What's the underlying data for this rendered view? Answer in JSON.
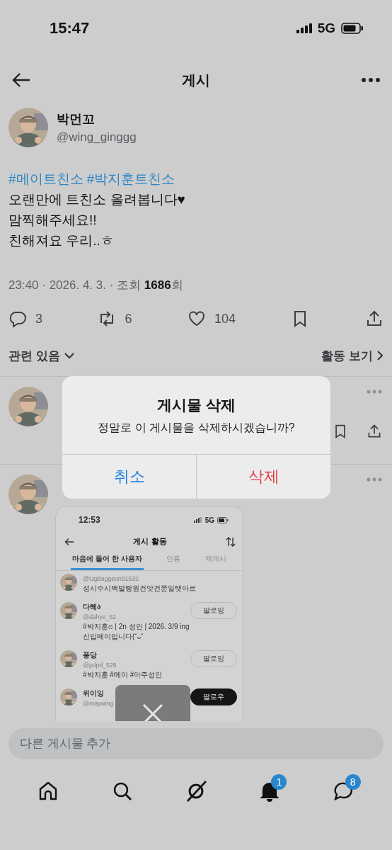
{
  "status_bar": {
    "time": "15:47",
    "network": "5G"
  },
  "header": {
    "title": "게시"
  },
  "post": {
    "author": {
      "name": "박먼꼬",
      "handle": "@wing_ginggg"
    },
    "hashtags": [
      "#메이트친소",
      "#박지훈트친소"
    ],
    "lines": [
      "오랜만에 트친소 올려봅니다♥",
      "맘찍해주세요!!",
      "친해져요 우리..ㅎ"
    ],
    "meta": "23:40 · 2026. 4. 3. · 조회 **1686**회",
    "actions": [
      {
        "kind": "reply",
        "count": "3"
      },
      {
        "kind": "repost",
        "count": "6"
      },
      {
        "kind": "like",
        "count": "104"
      },
      {
        "kind": "bookmark"
      },
      {
        "kind": "share"
      }
    ]
  },
  "replies_filter": {
    "label": "관련 있음",
    "link": "활동 보기"
  },
  "replies": [
    {
      "kind": "text"
    },
    {
      "image": {
        "time": "12:53",
        "network": "5G",
        "title": "게시 활동",
        "tabs": [
          {
            "label": "마음에 들어 한 사용자",
            "selected": true
          },
          {
            "label": "인용",
            "selected": false
          },
          {
            "label": "재게시",
            "selected": false
          }
        ],
        "users": [
          {
            "handle": "@UgBaggeon91532",
            "bio": [
              "성시수시백발랭원건앗건쭌일탯아르"
            ]
          },
          {
            "name": "다혜ა",
            "handle": "@dahye_52",
            "bio": [
              "#박지훈ෆ | 2n 성인 | 2026. 3/9 ing",
              "신입메이입니다(˘ᴗ˘"
            ],
            "button": "팔로잉",
            "following": true
          },
          {
            "name": "퐁당",
            "handle": "@pdpd_529",
            "bio": [
              "#박지훈 #메이 #아주성인"
            ],
            "button": "팔로잉",
            "following": true
          },
          {
            "name": "위이잉",
            "handle": "@maywing",
            "button": "팔로우",
            "following": false
          }
        ]
      }
    }
  ],
  "dialog": {
    "title": "게시물 삭제",
    "message": "정말로 이 게시물을 삭제하시겠습니까?",
    "buttons": [
      {
        "label": "취소",
        "kind": "cancel"
      },
      {
        "label": "삭제",
        "kind": "destructive"
      }
    ]
  },
  "composer": {
    "placeholder": "다른 게시물 추가"
  },
  "nav": [
    {
      "kind": "home",
      "selected": false
    },
    {
      "kind": "search",
      "selected": false
    },
    {
      "kind": "grok",
      "selected": false
    },
    {
      "kind": "notifications",
      "selected": true,
      "badge": "1"
    },
    {
      "kind": "messages",
      "selected": false,
      "badge": "8"
    }
  ]
}
